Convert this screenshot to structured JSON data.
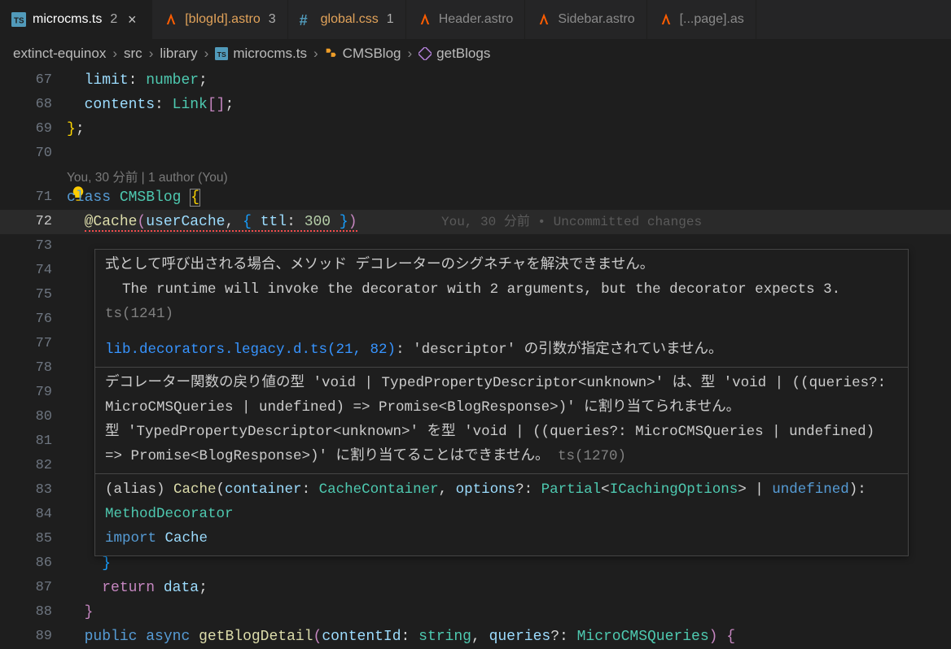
{
  "tabs": [
    {
      "icon": "ts",
      "label": "microcms.ts",
      "mod": "2",
      "active": true,
      "close": true
    },
    {
      "icon": "astro",
      "label": "[blogId].astro",
      "mod": "3",
      "active": false,
      "labelClass": "orange"
    },
    {
      "icon": "css",
      "label": "global.css",
      "mod": "1",
      "active": false,
      "labelClass": "orange"
    },
    {
      "icon": "astro",
      "label": "Header.astro",
      "mod": "",
      "active": false
    },
    {
      "icon": "astro",
      "label": "Sidebar.astro",
      "mod": "",
      "active": false
    },
    {
      "icon": "astro",
      "label": "[...page].as",
      "mod": "",
      "active": false
    }
  ],
  "breadcrumbs": {
    "items": [
      "extinct-equinox",
      "src",
      "library"
    ],
    "file": "microcms.ts",
    "class": "CMSBlog",
    "method": "getBlogs"
  },
  "codelens": "You, 30 分前 | 1 author (You)",
  "blame": "You, 30 分前 • Uncommitted changes",
  "lines": {
    "l67": {
      "num": "67"
    },
    "l68": {
      "num": "68"
    },
    "l69": {
      "num": "69"
    },
    "l70": {
      "num": "70"
    },
    "l71": {
      "num": "71"
    },
    "l72": {
      "num": "72"
    },
    "l73": {
      "num": "73"
    },
    "l74": {
      "num": "74"
    },
    "l75": {
      "num": "75"
    },
    "l76": {
      "num": "76"
    },
    "l77": {
      "num": "77"
    },
    "l78": {
      "num": "78"
    },
    "l79": {
      "num": "79"
    },
    "l80": {
      "num": "80"
    },
    "l81": {
      "num": "81"
    },
    "l82": {
      "num": "82"
    },
    "l83": {
      "num": "83"
    },
    "l84": {
      "num": "84"
    },
    "l85": {
      "num": "85"
    },
    "l86": {
      "num": "86"
    },
    "l87": {
      "num": "87"
    },
    "l88": {
      "num": "88"
    },
    "l89": {
      "num": "89"
    }
  },
  "code": {
    "l67_prop": "limit",
    "l67_type": "number",
    "l68_prop": "contents",
    "l68_type": "Link",
    "l71_kw": "class",
    "l71_name": "CMSBlog",
    "l72_dec": "@Cache",
    "l72_arg1": "userCache",
    "l72_key": "ttl",
    "l72_val": "300",
    "l87_kw": "return",
    "l87_var": "data",
    "l89_pub": "public",
    "l89_async": "async",
    "l89_fn": "getBlogDetail",
    "l89_p1": "contentId",
    "l89_t1": "string",
    "l89_p2": "queries",
    "l89_t2": "MicroCMSQueries"
  },
  "hover": {
    "s1_l1": "式として呼び出される場合、メソッド デコレーターのシグネチャを解決できません。",
    "s1_l2": "  The runtime will invoke the decorator with 2 arguments, but the decorator expects 3.",
    "s1_ts": "ts(1241)",
    "s1_link": "lib.decorators.legacy.d.ts(21, 82)",
    "s1_rest": ": 'descriptor' の引数が指定されていません。",
    "s2_l1": "デコレーター関数の戻り値の型 'void | TypedPropertyDescriptor<unknown>' は、型 'void | ((queries?: MicroCMSQueries | undefined) => Promise<BlogResponse>)' に割り当てられません。",
    "s2_l2": "  型 'TypedPropertyDescriptor<unknown>' を型 'void | ((queries?: MicroCMSQueries | undefined) => Promise<BlogResponse>)' に割り当てることはできません。",
    "s2_ts": "ts(1270)",
    "s3_alias": "(alias) ",
    "s3_fn": "Cache",
    "s3_p1": "container",
    "s3_t1": "CacheContainer",
    "s3_p2": "options",
    "s3_t2a": "Partial",
    "s3_t2b": "ICachingOptions",
    "s3_ret": "MethodDecorator",
    "s3_undef": "undefined",
    "s3_imp": "import",
    "s3_impname": "Cache"
  }
}
